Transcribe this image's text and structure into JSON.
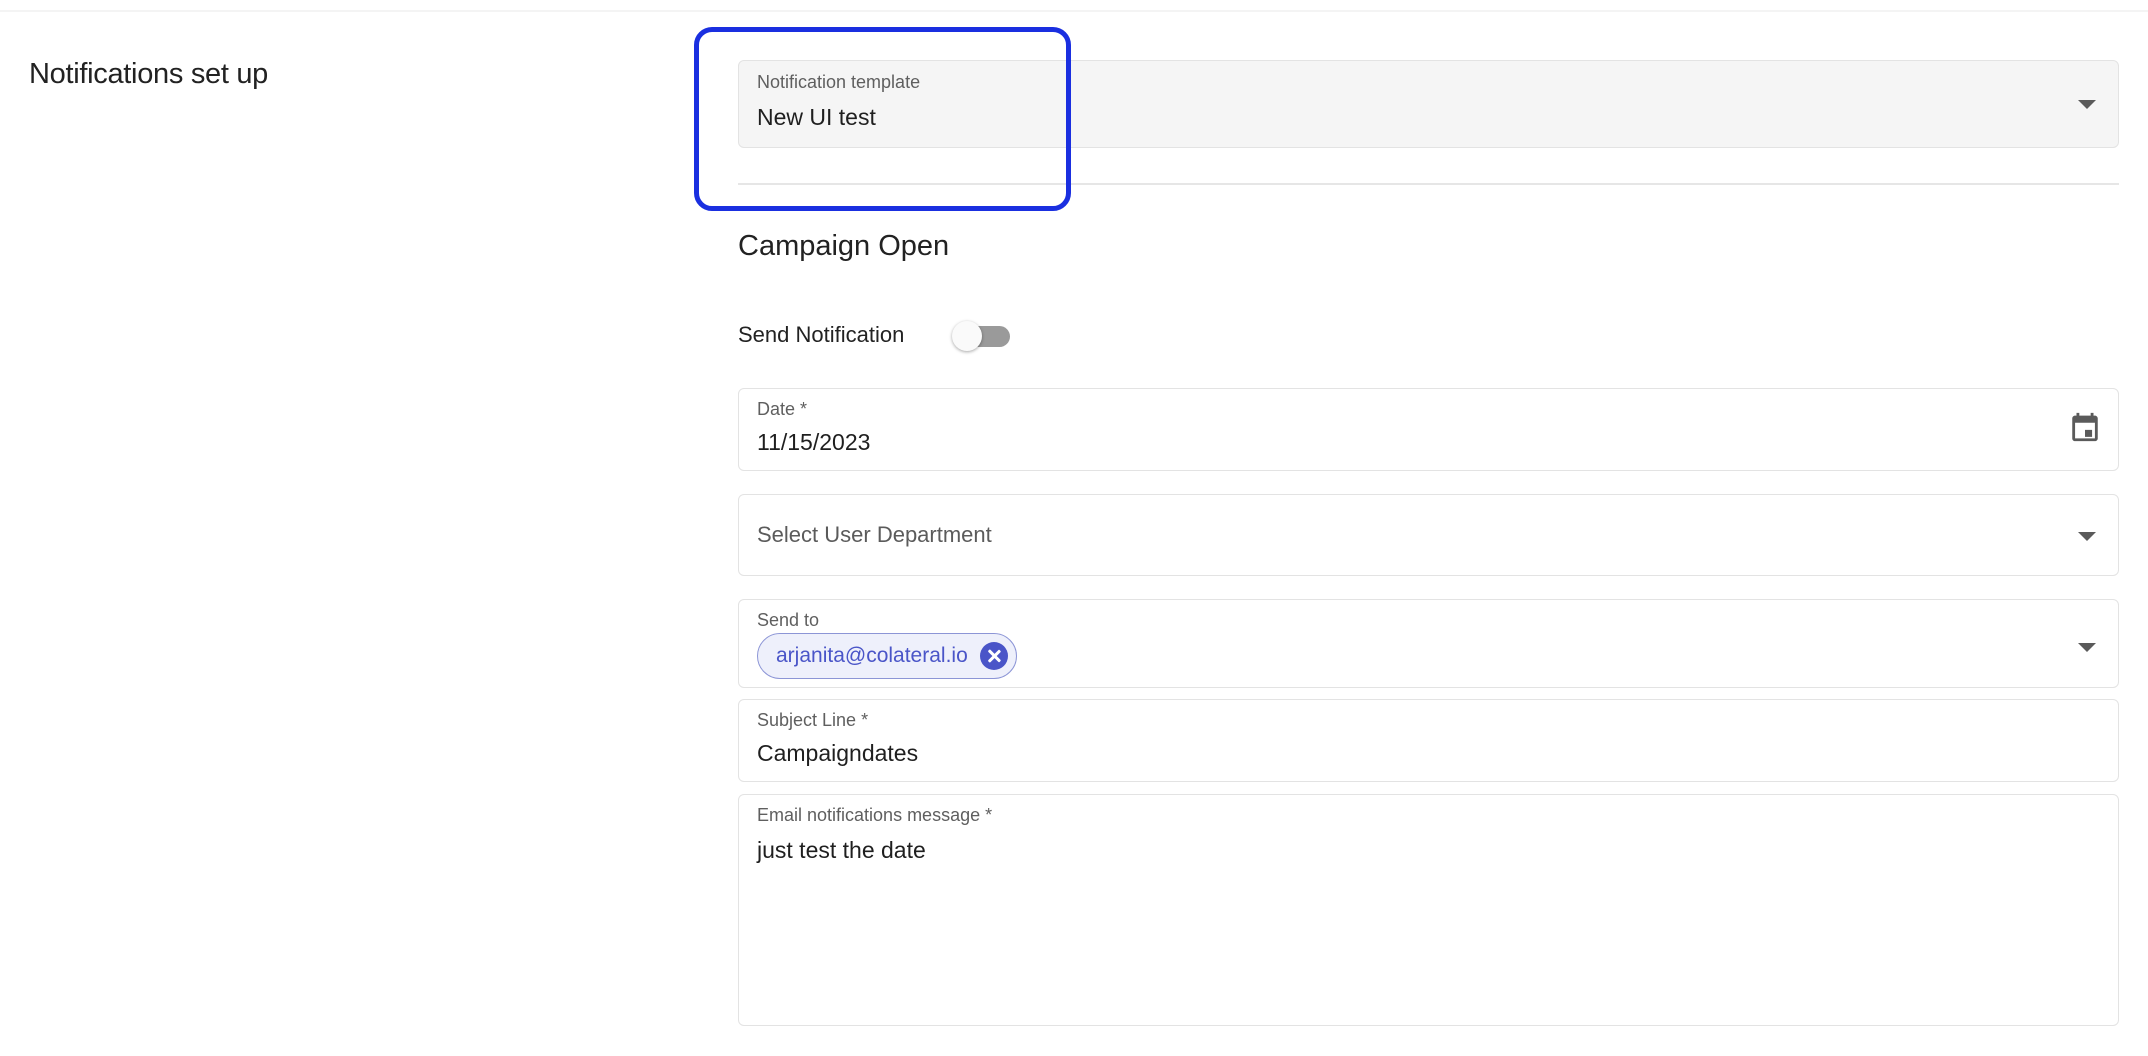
{
  "section": {
    "title": "Notifications set up"
  },
  "template_select": {
    "label": "Notification template",
    "value": "New UI test"
  },
  "campaign": {
    "heading": "Campaign Open",
    "send_notification_label": "Send Notification",
    "send_notification_on": false
  },
  "date_field": {
    "label": "Date *",
    "value": "11/15/2023"
  },
  "department_select": {
    "placeholder": "Select User Department"
  },
  "send_to": {
    "label": "Send to",
    "chips": [
      "arjanita@colateral.io"
    ]
  },
  "subject_field": {
    "label": "Subject Line *",
    "value": "Campaigndates"
  },
  "message_field": {
    "label": "Email notifications message *",
    "value": "just test the date"
  },
  "colors": {
    "highlight": "#1a2fe0",
    "chip_text": "#4a55c8",
    "chip_background": "#eef0fb"
  }
}
